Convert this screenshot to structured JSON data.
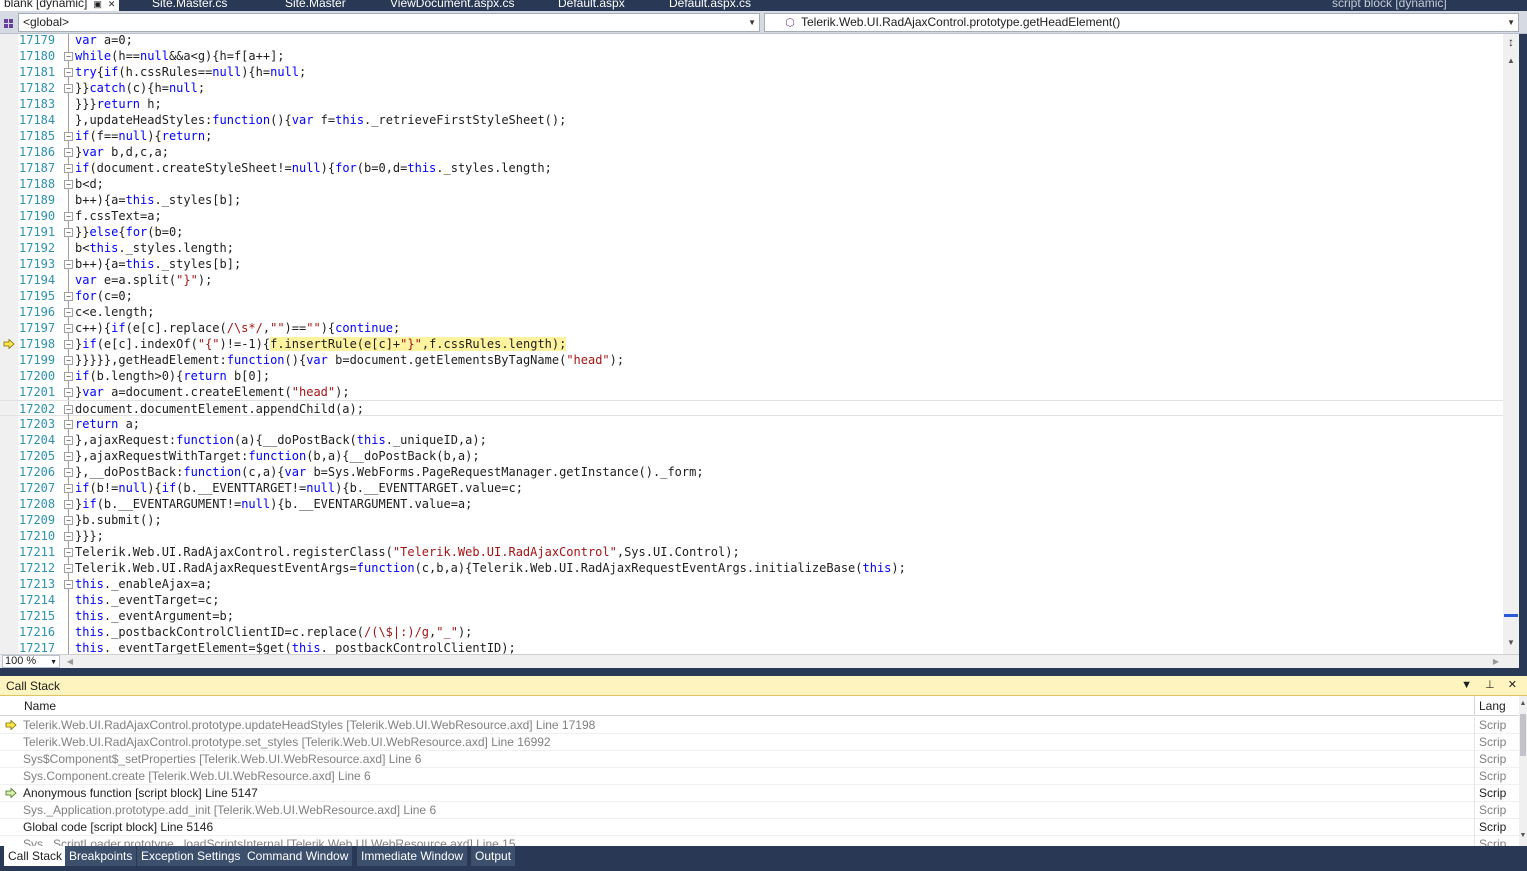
{
  "tabs": [
    {
      "label": "blank [dynamic]",
      "active": true
    },
    {
      "label": "Site.Master.cs"
    },
    {
      "label": "Site.Master"
    },
    {
      "label": "ViewDocument.aspx.cs"
    },
    {
      "label": "Default.aspx"
    },
    {
      "label": "Default.aspx.cs"
    },
    {
      "label": "script block [dynamic]"
    }
  ],
  "navbar": {
    "scope": "<global>",
    "member": "Telerik.Web.UI.RadAjaxControl.prototype.getHeadElement()"
  },
  "editor": {
    "zoom": "100 %",
    "lines": [
      {
        "num": "17179",
        "text": "var a=0;"
      },
      {
        "num": "17180",
        "text": "while(h==null&&a<g){h=f[a++];"
      },
      {
        "num": "17181",
        "text": "try{if(h.cssRules==null){h=null;"
      },
      {
        "num": "17182",
        "text": "}}catch(c){h=null;"
      },
      {
        "num": "17183",
        "text": "}}}return h;"
      },
      {
        "num": "17184",
        "text": "},updateHeadStyles:function(){var f=this._retrieveFirstStyleSheet();"
      },
      {
        "num": "17185",
        "text": "if(f==null){return;"
      },
      {
        "num": "17186",
        "text": "}var b,d,c,a;"
      },
      {
        "num": "17187",
        "text": "if(document.createStyleSheet!=null){for(b=0,d=this._styles.length;"
      },
      {
        "num": "17188",
        "text": "b<d;"
      },
      {
        "num": "17189",
        "text": "b++){a=this._styles[b];"
      },
      {
        "num": "17190",
        "text": "f.cssText=a;"
      },
      {
        "num": "17191",
        "text": "}}else{for(b=0;"
      },
      {
        "num": "17192",
        "text": "b<this._styles.length;"
      },
      {
        "num": "17193",
        "text": "b++){a=this._styles[b];"
      },
      {
        "num": "17194",
        "text": "var e=a.split(\"}\");"
      },
      {
        "num": "17195",
        "text": "for(c=0;"
      },
      {
        "num": "17196",
        "text": "c<e.length;"
      },
      {
        "num": "17197",
        "text": "c++){if(e[c].replace(/\\s*/,\"\")==\"\"){continue;"
      },
      {
        "num": "17198",
        "text": "}if(e[c].indexOf(\"{\")!=-1){f.insertRule(e[c]+\"}\",f.cssRules.length);"
      },
      {
        "num": "17199",
        "text": "}}}}},getHeadElement:function(){var b=document.getElementsByTagName(\"head\");"
      },
      {
        "num": "17200",
        "text": "if(b.length>0){return b[0];"
      },
      {
        "num": "17201",
        "text": "}var a=document.createElement(\"head\");"
      },
      {
        "num": "17202",
        "text": "document.documentElement.appendChild(a);"
      },
      {
        "num": "17203",
        "text": "return a;"
      },
      {
        "num": "17204",
        "text": "},ajaxRequest:function(a){__doPostBack(this._uniqueID,a);"
      },
      {
        "num": "17205",
        "text": "},ajaxRequestWithTarget:function(b,a){__doPostBack(b,a);"
      },
      {
        "num": "17206",
        "text": "},__doPostBack:function(c,a){var b=Sys.WebForms.PageRequestManager.getInstance()._form;"
      },
      {
        "num": "17207",
        "text": "if(b!=null){if(b.__EVENTTARGET!=null){b.__EVENTTARGET.value=c;"
      },
      {
        "num": "17208",
        "text": "}if(b.__EVENTARGUMENT!=null){b.__EVENTARGUMENT.value=a;"
      },
      {
        "num": "17209",
        "text": "}b.submit();"
      },
      {
        "num": "17210",
        "text": "}}};"
      },
      {
        "num": "17211",
        "text": "Telerik.Web.UI.RadAjaxControl.registerClass(\"Telerik.Web.UI.RadAjaxControl\",Sys.UI.Control);"
      },
      {
        "num": "17212",
        "text": "Telerik.Web.UI.RadAjaxRequestEventArgs=function(c,b,a){Telerik.Web.UI.RadAjaxRequestEventArgs.initializeBase(this);"
      },
      {
        "num": "17213",
        "text": "this._enableAjax=a;"
      },
      {
        "num": "17214",
        "text": "this._eventTarget=c;"
      },
      {
        "num": "17215",
        "text": "this._eventArgument=b;"
      },
      {
        "num": "17216",
        "text": "this._postbackControlClientID=c.replace(/(\\$|:)/g,\"_\");"
      },
      {
        "num": "17217",
        "text": "this._eventTargetElement=$get(this._postbackControlClientID);"
      }
    ]
  },
  "callstack": {
    "title": "Call Stack",
    "columns": {
      "name": "Name",
      "lang": "Lang"
    },
    "rows": [
      {
        "name": "Telerik.Web.UI.RadAjaxControl.prototype.updateHeadStyles [Telerik.Web.UI.WebResource.axd] Line 17198",
        "lang": "Scrip",
        "style": "dim",
        "icon": "current"
      },
      {
        "name": "Telerik.Web.UI.RadAjaxControl.prototype.set_styles [Telerik.Web.UI.WebResource.axd] Line 16992",
        "lang": "Scrip",
        "style": "dim"
      },
      {
        "name": "Sys$Component$_setProperties [Telerik.Web.UI.WebResource.axd] Line 6",
        "lang": "Scrip",
        "style": "dim"
      },
      {
        "name": "Sys.Component.create [Telerik.Web.UI.WebResource.axd] Line 6",
        "lang": "Scrip",
        "style": "dim"
      },
      {
        "name": "Anonymous function [script block] Line 5147",
        "lang": "Scrip",
        "style": "norm",
        "icon": "return"
      },
      {
        "name": "Sys._Application.prototype.add_init [Telerik.Web.UI.WebResource.axd] Line 6",
        "lang": "Scrip",
        "style": "dim"
      },
      {
        "name": "Global code [script block] Line 5146",
        "lang": "Scrip",
        "style": "norm"
      },
      {
        "name": "Sys._ScriptLoader.prototype._loadScriptsInternal [Telerik.Web.UI.WebResource.axd] Line 15",
        "lang": "Scrip",
        "style": "dim"
      }
    ]
  },
  "bottom_tabs": [
    {
      "label": "Call Stack",
      "active": true
    },
    {
      "label": "Breakpoints"
    },
    {
      "label": "Exception Settings"
    },
    {
      "label": "Command Window"
    },
    {
      "label": "Immediate Window"
    },
    {
      "label": "Output"
    }
  ],
  "colors": {
    "chrome": "#293955",
    "keyword": "#0000ff",
    "string": "#a31515",
    "line_number": "#2b91af",
    "statement_highlight": "#fff3a0",
    "panel_title": "#fdf4bf"
  }
}
